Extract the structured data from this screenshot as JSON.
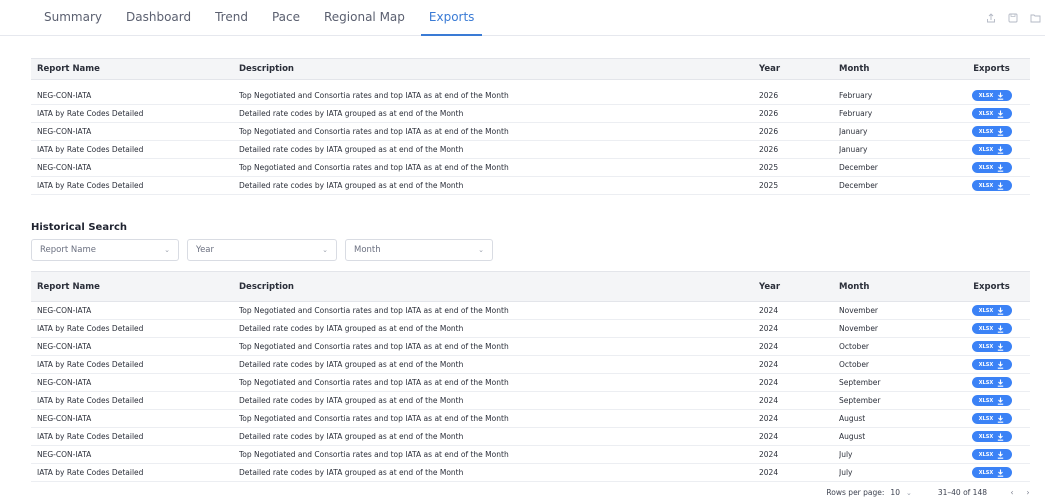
{
  "nav": {
    "tabs": [
      {
        "label": "Summary"
      },
      {
        "label": "Dashboard"
      },
      {
        "label": "Trend"
      },
      {
        "label": "Pace"
      },
      {
        "label": "Regional Map"
      },
      {
        "label": "Exports"
      }
    ],
    "active_tab": "Exports",
    "icons": [
      "share-icon",
      "save-icon",
      "folder-icon"
    ]
  },
  "columns": {
    "name": "Report Name",
    "desc": "Description",
    "year": "Year",
    "month": "Month",
    "exports": "Exports"
  },
  "export_button_label": "XLSX",
  "current_rows": [
    {
      "name": "NEG-CON-IATA",
      "desc": "Top Negotiated and Consortia rates and top IATA as at end of the Month",
      "year": "2026",
      "month": "February"
    },
    {
      "name": "IATA by Rate Codes Detailed",
      "desc": "Detailed rate codes by IATA grouped as at end of the Month",
      "year": "2026",
      "month": "February"
    },
    {
      "name": "NEG-CON-IATA",
      "desc": "Top Negotiated and Consortia rates and top IATA as at end of the Month",
      "year": "2026",
      "month": "January"
    },
    {
      "name": "IATA by Rate Codes Detailed",
      "desc": "Detailed rate codes by IATA grouped as at end of the Month",
      "year": "2026",
      "month": "January"
    },
    {
      "name": "NEG-CON-IATA",
      "desc": "Top Negotiated and Consortia rates and top IATA as at end of the Month",
      "year": "2025",
      "month": "December"
    },
    {
      "name": "IATA by Rate Codes Detailed",
      "desc": "Detailed rate codes by IATA grouped as at end of the Month",
      "year": "2025",
      "month": "December"
    }
  ],
  "historical": {
    "title": "Historical Search",
    "filters": {
      "report_name": "Report Name",
      "year": "Year",
      "month": "Month"
    },
    "rows": [
      {
        "name": "NEG-CON-IATA",
        "desc": "Top Negotiated and Consortia rates and top IATA as at end of the Month",
        "year": "2024",
        "month": "November"
      },
      {
        "name": "IATA by Rate Codes Detailed",
        "desc": "Detailed rate codes by IATA grouped as at end of the Month",
        "year": "2024",
        "month": "November"
      },
      {
        "name": "NEG-CON-IATA",
        "desc": "Top Negotiated and Consortia rates and top IATA as at end of the Month",
        "year": "2024",
        "month": "October"
      },
      {
        "name": "IATA by Rate Codes Detailed",
        "desc": "Detailed rate codes by IATA grouped as at end of the Month",
        "year": "2024",
        "month": "October"
      },
      {
        "name": "NEG-CON-IATA",
        "desc": "Top Negotiated and Consortia rates and top IATA as at end of the Month",
        "year": "2024",
        "month": "September"
      },
      {
        "name": "IATA by Rate Codes Detailed",
        "desc": "Detailed rate codes by IATA grouped as at end of the Month",
        "year": "2024",
        "month": "September"
      },
      {
        "name": "NEG-CON-IATA",
        "desc": "Top Negotiated and Consortia rates and top IATA as at end of the Month",
        "year": "2024",
        "month": "August"
      },
      {
        "name": "IATA by Rate Codes Detailed",
        "desc": "Detailed rate codes by IATA grouped as at end of the Month",
        "year": "2024",
        "month": "August"
      },
      {
        "name": "NEG-CON-IATA",
        "desc": "Top Negotiated and Consortia rates and top IATA as at end of the Month",
        "year": "2024",
        "month": "July"
      },
      {
        "name": "IATA by Rate Codes Detailed",
        "desc": "Detailed rate codes by IATA grouped as at end of the Month",
        "year": "2024",
        "month": "July"
      }
    ]
  },
  "pagination": {
    "rows_per_page_label": "Rows per page:",
    "rows_per_page_value": "10",
    "range_text": "31–40 of 148",
    "prev": "‹",
    "next": "›"
  },
  "colors": {
    "accent": "#3a7bd5",
    "export_button": "#3b82f6"
  }
}
